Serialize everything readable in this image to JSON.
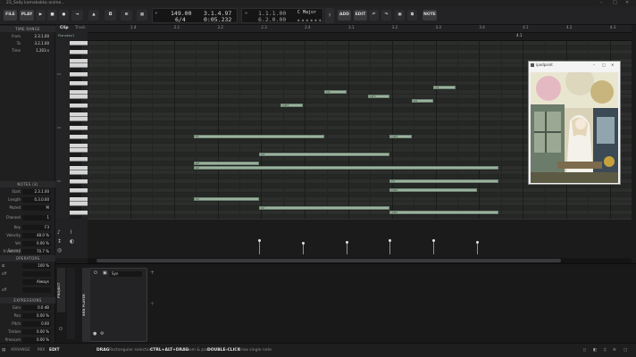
{
  "window": {
    "title": "23_Sally kamakakka anime..."
  },
  "transport": {
    "file_label": "FILE",
    "play_label": "PLAY",
    "tempo": "149.00",
    "time_sig": "6/4",
    "position_beats": "3.1.4.97",
    "position_time": "0:05.232",
    "loop_start": "1.1.1.00",
    "loop_length": "6.2.0.00",
    "key": "C Major",
    "add_label": "ADD",
    "edit_label": "EDIT",
    "note_label": "NOTE"
  },
  "editor_tabs": {
    "clip": "Clip",
    "track": "Track",
    "clip_name": "Pianokey1"
  },
  "ruler": [
    "1.4",
    "2.1",
    "2.2",
    "2.3",
    "2.4",
    "3.1",
    "3.2",
    "3.3",
    "3.4",
    "4.1",
    "4.2",
    "4.3"
  ],
  "ruler2_right": "4.1",
  "time_range": {
    "header": "TIME RANGE",
    "rows": [
      {
        "label": "From",
        "value": "2.3.1.00"
      },
      {
        "label": "To",
        "value": "3.2.1.00"
      },
      {
        "label": "Time",
        "value": "1.203 s"
      }
    ]
  },
  "notes_panel": {
    "header": "NOTES (3)",
    "rows": [
      {
        "label": "Start",
        "value": "2.3.1.00"
      },
      {
        "label": "Length",
        "value": "0.3.0.00"
      },
      {
        "label": "Muted",
        "value": "M"
      },
      {
        "label": "Channel",
        "value": "1"
      },
      {
        "label": "Key",
        "value": "F3"
      },
      {
        "label": "Velocity",
        "value": "48.0 %"
      },
      {
        "label": "Vel Spread",
        "value": "0.00 %"
      },
      {
        "label": "R-Velocity",
        "value": "70.7 %"
      }
    ]
  },
  "operators": {
    "header": "OPERATORS",
    "rows": [
      {
        "label": "",
        "value": "100 %"
      },
      {
        "label": "off",
        "value": ""
      },
      {
        "label": "",
        "value": "Always"
      },
      {
        "label": "off",
        "value": ""
      }
    ]
  },
  "expressions": {
    "header": "EXPRESSIONS",
    "rows": [
      {
        "label": "Gain",
        "value": "0.0 dB"
      },
      {
        "label": "Pan",
        "value": "0.00 %"
      },
      {
        "label": "Pitch",
        "value": "0.00"
      },
      {
        "label": "Timbre",
        "value": "0.00 %"
      },
      {
        "label": "Pressure",
        "value": "0.00 %"
      }
    ]
  },
  "keyboard": {
    "c_labels": [
      "C4",
      "C3",
      "C2"
    ]
  },
  "notes": [
    {
      "label": "C4",
      "lane": 10,
      "start": 2.0,
      "len": 0.25
    },
    {
      "label": "A#3",
      "lane": 12,
      "start": 1.25,
      "len": 0.25
    },
    {
      "label": "G#3",
      "lane": 14,
      "start": 0.25,
      "len": 0.25
    },
    {
      "label": "D3",
      "lane": 11,
      "start": 0.75,
      "len": 0.25
    },
    {
      "label": "G3",
      "lane": 13,
      "start": 1.75,
      "len": 0.25
    },
    {
      "label": "F3",
      "lane": 21,
      "start": -0.75,
      "len": 1.5
    },
    {
      "label": "D#3",
      "lane": 21,
      "start": 1.5,
      "len": 0.25
    },
    {
      "label": "C3",
      "lane": 25,
      "start": 0.0,
      "len": 1.5
    },
    {
      "label": "A2",
      "lane": 28,
      "start": -0.75,
      "len": 3.5
    },
    {
      "label": "G2",
      "lane": 27,
      "start": -0.75,
      "len": 0.75
    },
    {
      "label": "F2",
      "lane": 31,
      "start": 1.5,
      "len": 1.25
    },
    {
      "label": "D#2",
      "lane": 33,
      "start": 1.5,
      "len": 1.0
    },
    {
      "label": "C2",
      "lane": 35,
      "start": -0.75,
      "len": 0.75
    },
    {
      "label": "C2",
      "lane": 37,
      "start": 0.0,
      "len": 1.5
    },
    {
      "label": "A#1",
      "lane": 38,
      "start": 1.5,
      "len": 1.25
    }
  ],
  "velocities": [
    {
      "beat": 0.0,
      "velocity": 0.48
    },
    {
      "beat": 0.5,
      "velocity": 0.38
    },
    {
      "beat": 1.0,
      "velocity": 0.42
    },
    {
      "beat": 1.5,
      "velocity": 0.46
    },
    {
      "beat": 2.0,
      "velocity": 0.46
    },
    {
      "beat": 2.5,
      "velocity": 0.4
    }
  ],
  "image_window": {
    "title": "ipadpaint"
  },
  "bottom": {
    "project_tab": "PROJECT",
    "device_tab": "BRB PLAYER",
    "device_name": "Syn"
  },
  "status": {
    "arrange": "ARRANGE",
    "mix": "MIX",
    "edit": "EDIT",
    "drag_key": "DRAG",
    "drag_desc": "Rectangular selection",
    "ctrl_key": "CTRL+ALT+DRAG",
    "ctrl_desc": "Zoom & pan",
    "dbl_key": "DOUBLE-CLICK",
    "dbl_desc": "Draw single note"
  }
}
